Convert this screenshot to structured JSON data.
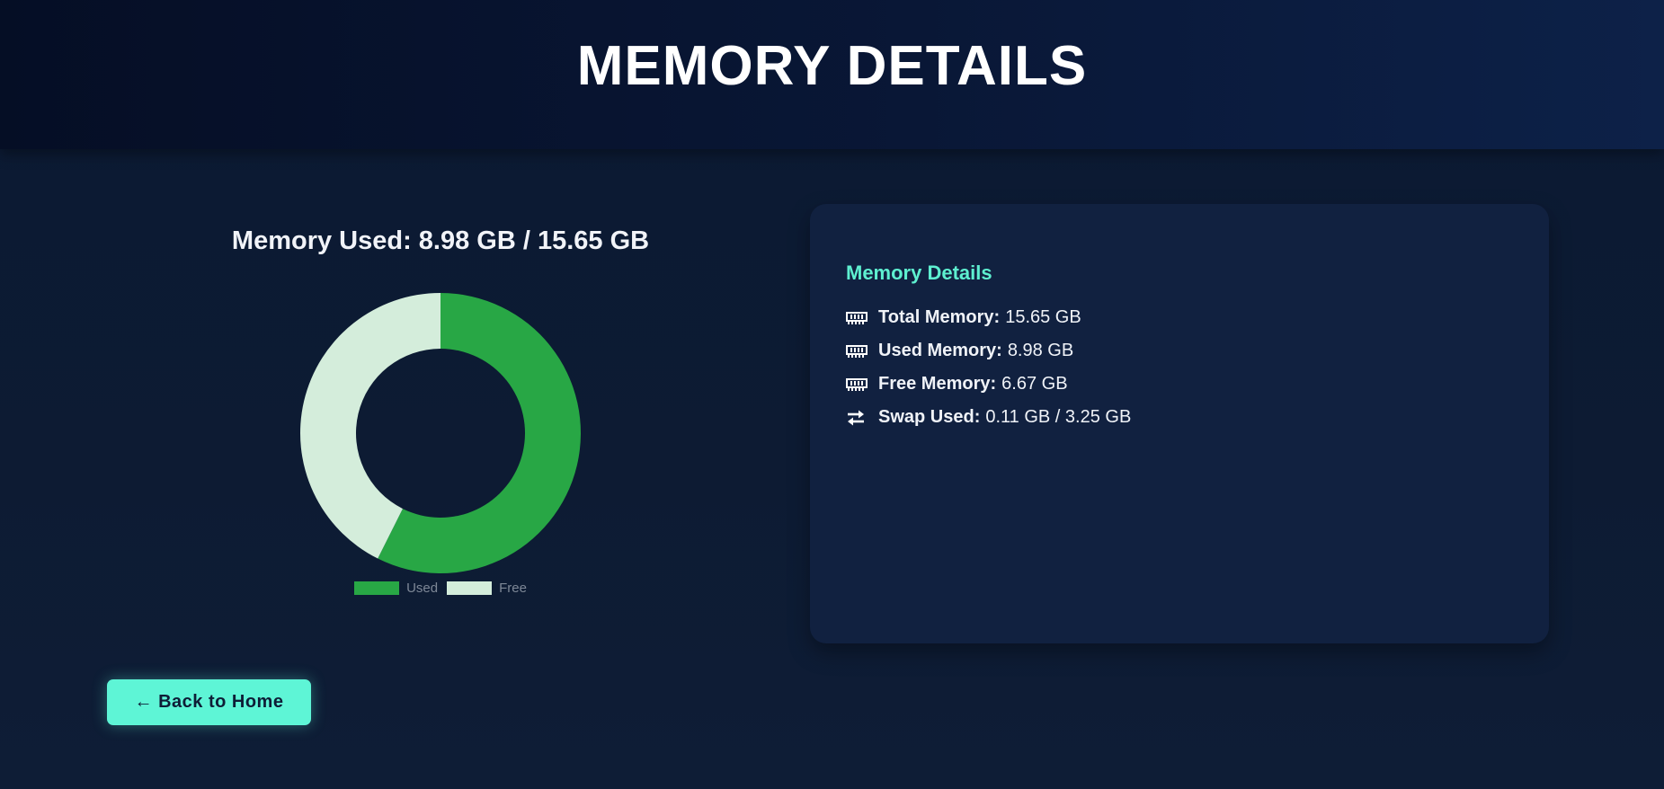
{
  "header": {
    "title": "MEMORY DETAILS"
  },
  "chart_section": {
    "title": "Memory Used: 8.98 GB / 15.65 GB"
  },
  "chart_data": {
    "type": "pie",
    "variant": "donut",
    "categories": [
      "Used",
      "Free"
    ],
    "values": [
      8.98,
      6.67
    ],
    "colors": [
      "#28a745",
      "#d4eddb"
    ],
    "legend_position": "bottom"
  },
  "details_card": {
    "title": "Memory Details",
    "rows": [
      {
        "icon": "memory-icon",
        "label": "Total Memory:",
        "value": "15.65 GB"
      },
      {
        "icon": "memory-icon",
        "label": "Used Memory:",
        "value": "8.98 GB"
      },
      {
        "icon": "memory-icon",
        "label": "Free Memory:",
        "value": "6.67 GB"
      },
      {
        "icon": "swap-icon",
        "label": "Swap Used:",
        "value": "0.11 GB / 3.25 GB"
      }
    ]
  },
  "back_button": {
    "label": "← Back to Home"
  },
  "colors": {
    "accent": "#5ef0d0",
    "used": "#28a745",
    "free": "#d4eddb"
  }
}
